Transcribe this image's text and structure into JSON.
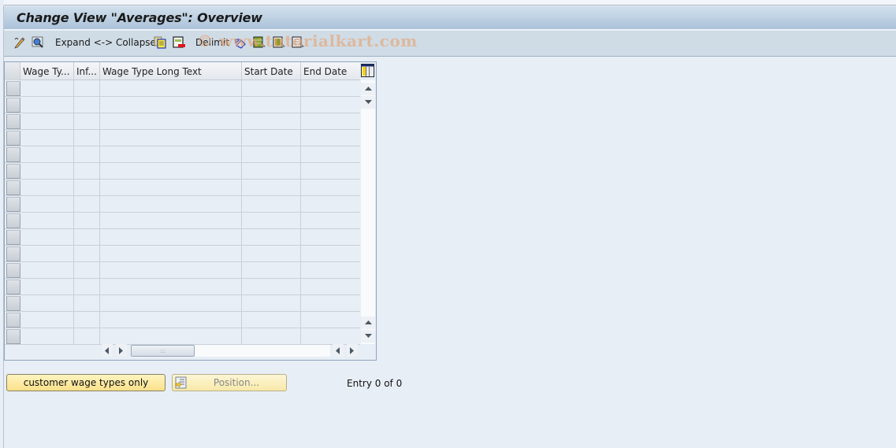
{
  "window": {
    "title": "Change View \"Averages\": Overview"
  },
  "toolbar": {
    "items": [
      {
        "name": "display-change-icon",
        "label": ""
      },
      {
        "name": "select-icon",
        "label": ""
      },
      {
        "name": "expand-collapse",
        "label": "Expand <-> Collapse"
      },
      {
        "name": "copy-as-icon",
        "label": ""
      },
      {
        "name": "delete-icon",
        "label": ""
      },
      {
        "name": "delimit",
        "label": "Delimit"
      },
      {
        "name": "undo-change-icon",
        "label": ""
      },
      {
        "name": "select-all-icon",
        "label": ""
      },
      {
        "name": "select-block-icon",
        "label": ""
      },
      {
        "name": "deselect-all-icon",
        "label": ""
      }
    ],
    "watermark": "© www.tutorialkart.com"
  },
  "table": {
    "columns": [
      {
        "key": "wage_type",
        "label": "Wage Ty..."
      },
      {
        "key": "infotype",
        "label": "Inf..."
      },
      {
        "key": "long_text",
        "label": "Wage Type Long Text"
      },
      {
        "key": "start_date",
        "label": "Start Date"
      },
      {
        "key": "end_date",
        "label": "End Date"
      }
    ],
    "rows": [],
    "visible_empty_rows": 16
  },
  "buttons": {
    "customer_wage_types": "customer wage types only",
    "position": "Position..."
  },
  "status": {
    "entry_text": "Entry 0 of 0"
  }
}
